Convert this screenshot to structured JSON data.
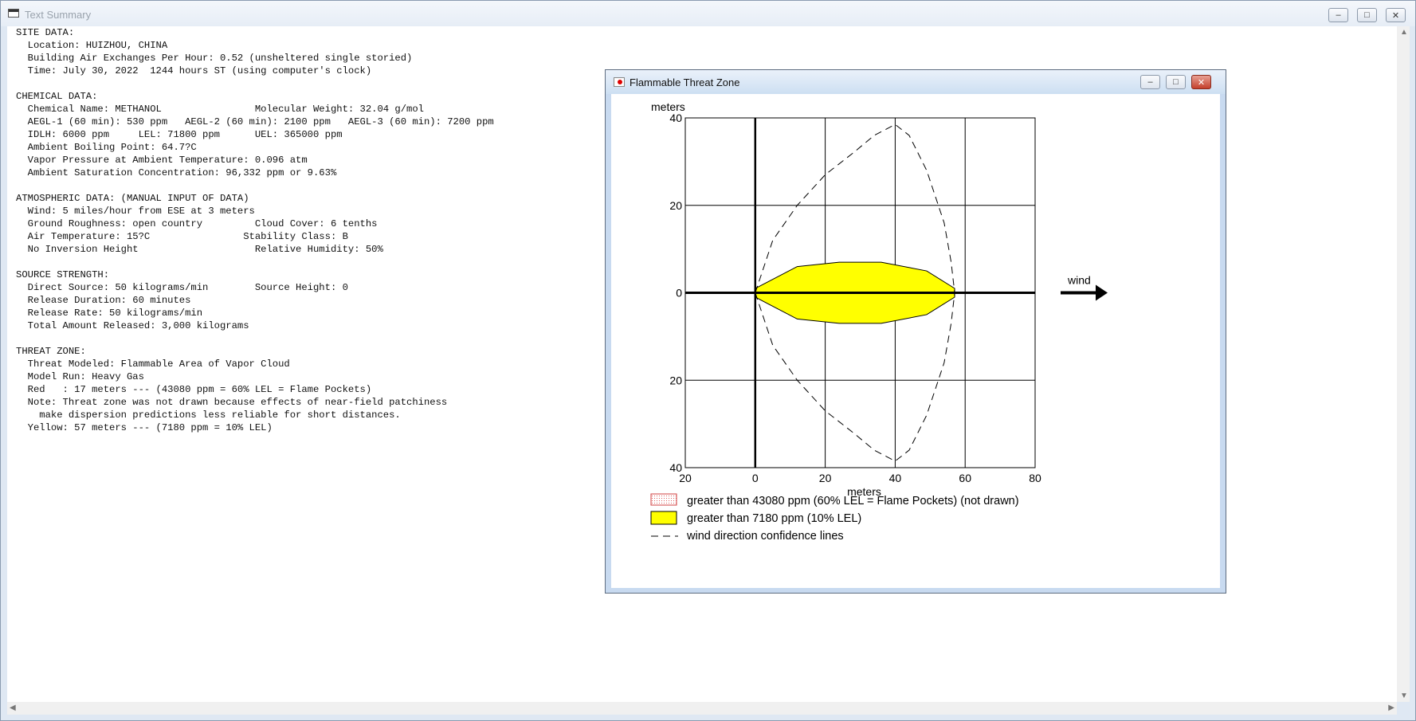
{
  "main_window": {
    "title": "Text Summary"
  },
  "summary_lines": [
    "SITE DATA:",
    "  Location: HUIZHOU, CHINA",
    "  Building Air Exchanges Per Hour: 0.52 (unsheltered single storied)",
    "  Time: July 30, 2022  1244 hours ST (using computer's clock)",
    "",
    "CHEMICAL DATA:",
    "  Chemical Name: METHANOL                Molecular Weight: 32.04 g/mol",
    "  AEGL-1 (60 min): 530 ppm   AEGL-2 (60 min): 2100 ppm   AEGL-3 (60 min): 7200 ppm",
    "  IDLH: 6000 ppm     LEL: 71800 ppm      UEL: 365000 ppm",
    "  Ambient Boiling Point: 64.7?C",
    "  Vapor Pressure at Ambient Temperature: 0.096 atm",
    "  Ambient Saturation Concentration: 96,332 ppm or 9.63%",
    "",
    "ATMOSPHERIC DATA: (MANUAL INPUT OF DATA)",
    "  Wind: 5 miles/hour from ESE at 3 meters",
    "  Ground Roughness: open country         Cloud Cover: 6 tenths",
    "  Air Temperature: 15?C                Stability Class: B",
    "  No Inversion Height                    Relative Humidity: 50%",
    "",
    "SOURCE STRENGTH:",
    "  Direct Source: 50 kilograms/min        Source Height: 0",
    "  Release Duration: 60 minutes",
    "  Release Rate: 50 kilograms/min",
    "  Total Amount Released: 3,000 kilograms",
    "",
    "THREAT ZONE:",
    "  Threat Modeled: Flammable Area of Vapor Cloud",
    "  Model Run: Heavy Gas",
    "  Red   : 17 meters --- (43080 ppm = 60% LEL = Flame Pockets)",
    "  Note: Threat zone was not drawn because effects of near-field patchiness",
    "    make dispersion predictions less reliable for short distances.",
    "  Yellow: 57 meters --- (7180 ppm = 10% LEL)"
  ],
  "threat_window": {
    "title": "Flammable Threat Zone"
  },
  "chart_data": {
    "type": "area",
    "xlabel": "meters",
    "ylabel": "meters",
    "xlim": [
      -20,
      80
    ],
    "ylim": [
      -40,
      40
    ],
    "x_ticks": [
      "20",
      "0",
      "20",
      "40",
      "60",
      "80"
    ],
    "y_ticks": [
      "40",
      "20",
      "0",
      "20",
      "40"
    ],
    "x_tick_values": [
      -20,
      0,
      20,
      40,
      60,
      80
    ],
    "y_tick_values": [
      40,
      20,
      0,
      -20,
      -40
    ],
    "grid": true,
    "wind_label": "wind",
    "yellow_zone": {
      "color": "#ffff00",
      "x": [
        0,
        12,
        24,
        36,
        49,
        57,
        57,
        49,
        36,
        24,
        12,
        0
      ],
      "y": [
        1,
        6,
        7,
        7,
        5,
        1,
        -1,
        -5,
        -7,
        -7,
        -6,
        -1
      ]
    },
    "confidence_lines": {
      "upper": {
        "x": [
          0,
          5,
          12,
          20,
          28,
          34,
          40,
          44,
          49,
          54,
          56,
          57
        ],
        "y": [
          0,
          12,
          20,
          27,
          32,
          36,
          38.5,
          36,
          28,
          16,
          7,
          0
        ]
      },
      "lower": {
        "x": [
          0,
          5,
          12,
          20,
          28,
          34,
          40,
          44,
          49,
          54,
          56,
          57
        ],
        "y": [
          0,
          -12,
          -20,
          -27,
          -32,
          -36,
          -38.5,
          -36,
          -28,
          -16,
          -7,
          0
        ]
      }
    },
    "legend": [
      {
        "label": "greater than 43080 ppm (60% LEL = Flame Pockets) (not drawn)",
        "swatch": "red-dotted"
      },
      {
        "label": "greater than 7180 ppm (10% LEL)",
        "swatch": "yellow"
      },
      {
        "label": "wind direction confidence lines",
        "swatch": "dashed"
      }
    ]
  }
}
